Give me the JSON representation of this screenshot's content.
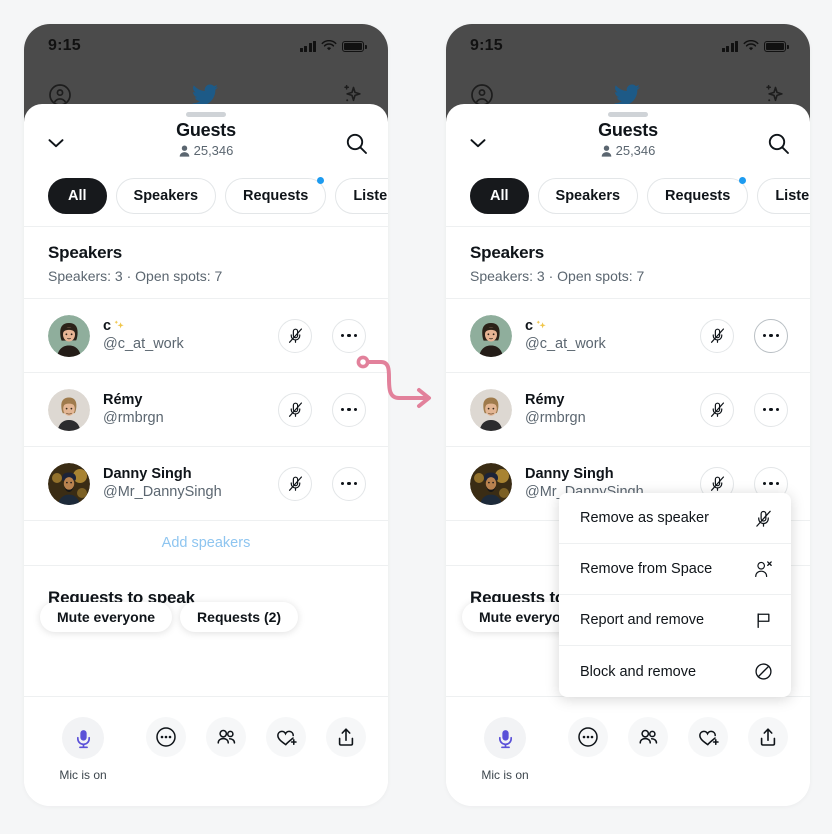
{
  "theme": {
    "page_bg": "#f5f6f7",
    "panel_bg": "#ffffff",
    "chrome_bg": "#4b4b4b",
    "accent_blue": "#1d9bf0",
    "link_blue": "#8ec5f0",
    "mic_purple": "#5b51d8",
    "text_primary": "#0f1419",
    "text_secondary": "#5b6670",
    "connector_pink": "#e2819b"
  },
  "status_bar": {
    "time": "9:15",
    "signal_icon": "cellular-bars-icon",
    "wifi_icon": "wifi-icon",
    "battery_icon": "battery-full-icon"
  },
  "app_bar": {
    "account_icon": "account-circle-icon",
    "logo_icon": "twitter-bird-icon",
    "sparkle_icon": "sparkle-icon"
  },
  "sheet": {
    "grabber": "drag-handle",
    "collapse_icon": "chevron-down-icon",
    "search_icon": "search-icon",
    "title": "Guests",
    "count_icon": "person-icon",
    "count": "25,346"
  },
  "tabs": [
    {
      "label": "All",
      "active": true,
      "badge": false
    },
    {
      "label": "Speakers",
      "active": false,
      "badge": false
    },
    {
      "label": "Requests",
      "active": false,
      "badge": true
    },
    {
      "label": "Listening",
      "active": false,
      "badge": false
    }
  ],
  "speakers_section": {
    "title": "Speakers",
    "subtitle": "Speakers: 3 · Open spots: 7",
    "add_speakers_label": "Add speakers",
    "rows": [
      {
        "name": "c",
        "name_suffix_icon": "sparkles-emoji",
        "handle": "@c_at_work",
        "avatar": "avatar-c-at-work",
        "mic_icon": "mic-muted-icon",
        "more_icon": "more-horizontal-icon"
      },
      {
        "name": "Rémy",
        "handle": "@rmbrgn",
        "avatar": "avatar-remy",
        "mic_icon": "mic-muted-icon",
        "more_icon": "more-horizontal-icon"
      },
      {
        "name": "Danny Singh",
        "handle": "@Mr_DannySingh",
        "avatar": "avatar-danny-singh",
        "mic_icon": "mic-muted-icon",
        "more_icon": "more-horizontal-icon"
      }
    ]
  },
  "requests_section": {
    "title": "Requests to speak",
    "pills": [
      {
        "label": "Mute everyone"
      },
      {
        "label": "Requests (2)"
      }
    ]
  },
  "bottom_bar": {
    "mic_icon": "microphone-icon",
    "mic_label": "Mic is on",
    "actions": [
      {
        "icon": "more-circle-icon",
        "name": "more-options-button"
      },
      {
        "icon": "people-icon",
        "name": "people-button"
      },
      {
        "icon": "heart-plus-icon",
        "name": "react-button"
      },
      {
        "icon": "share-icon",
        "name": "share-button"
      }
    ]
  },
  "context_menu": {
    "items": [
      {
        "label": "Remove as speaker",
        "icon": "mic-muted-icon"
      },
      {
        "label": "Remove from Space",
        "icon": "person-remove-icon"
      },
      {
        "label": "Report and remove",
        "icon": "flag-icon"
      },
      {
        "label": "Block and remove",
        "icon": "block-icon"
      }
    ]
  },
  "connector": {
    "name": "flow-arrow",
    "from": "left-panel-more-button",
    "to": "right-panel-context-menu"
  }
}
